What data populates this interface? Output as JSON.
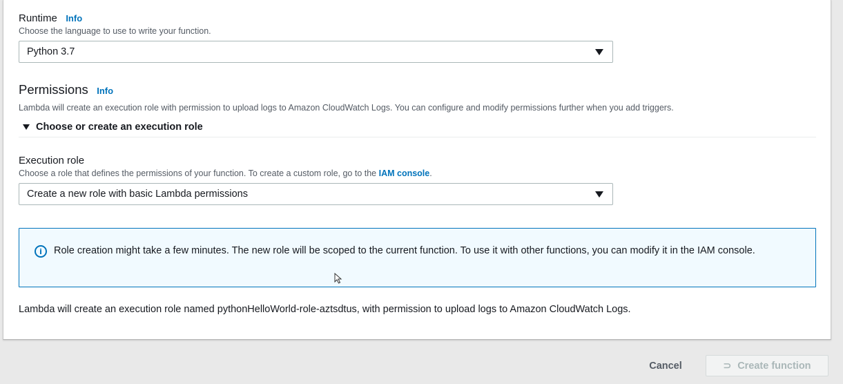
{
  "runtime": {
    "label": "Runtime",
    "info": "Info",
    "description": "Choose the language to use to write your function.",
    "selected": "Python 3.7"
  },
  "permissions": {
    "heading": "Permissions",
    "info": "Info",
    "description": "Lambda will create an execution role with permission to upload logs to Amazon CloudWatch Logs. You can configure and modify permissions further when you add triggers.",
    "expander_label": "Choose or create an execution role"
  },
  "execution_role": {
    "label": "Execution role",
    "description_prefix": "Choose a role that defines the permissions of your function. To create a custom role, go to the",
    "description_link": "IAM console",
    "description_suffix": ".",
    "selected": "Create a new role with basic Lambda permissions"
  },
  "alert": {
    "icon": "info-circle-icon",
    "text": "Role creation might take a few minutes. The new role will be scoped to the current function. To use it with other functions, you can modify it in the IAM console."
  },
  "role_note": "Lambda will create an execution role named pythonHelloWorld-role-aztsdtus, with permission to upload logs to Amazon CloudWatch Logs.",
  "footer": {
    "cancel_label": "Cancel",
    "create_label": "Create function",
    "create_icon": "spinner-icon"
  },
  "colors": {
    "link": "#0073bb",
    "alert_bg": "#f1faff",
    "alert_border": "#0073bb",
    "disabled_text": "#aab7b8"
  }
}
